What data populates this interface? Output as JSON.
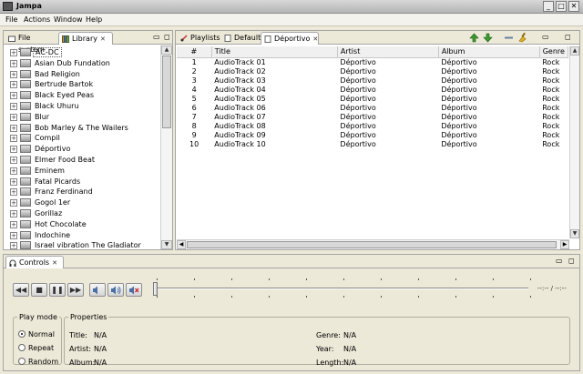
{
  "window": {
    "title": "Jampa",
    "min": "_",
    "max": "□",
    "close": "✕"
  },
  "menu": [
    "File",
    "Actions",
    "Window",
    "Help"
  ],
  "left_tabs": [
    {
      "label": "File system"
    },
    {
      "label": "Library"
    }
  ],
  "artists": [
    "AC-DC",
    "Asian Dub Fundation",
    "Bad Religion",
    "Bertrude Bartok",
    "Black Eyed Peas",
    "Black Uhuru",
    "Blur",
    "Bob Marley & The Wailers",
    "Compil",
    "Déportivo",
    "Elmer Food Beat",
    "Eminem",
    "Fatal Picards",
    "Franz Ferdinand",
    "Gogol 1er",
    "Gorillaz",
    "Hot Chocolate",
    "Indochine",
    "Israel vibration The Gladiator"
  ],
  "right_tabs": [
    {
      "label": "Playlists"
    },
    {
      "label": "Default"
    },
    {
      "label": "Déportivo"
    }
  ],
  "track_table": {
    "columns": [
      "#",
      "Title",
      "Artist",
      "Album",
      "Genre"
    ],
    "rows": [
      [
        "1",
        "AudioTrack 01",
        "Déportivo",
        "Déportivo",
        "Rock"
      ],
      [
        "2",
        "AudioTrack 02",
        "Déportivo",
        "Déportivo",
        "Rock"
      ],
      [
        "3",
        "AudioTrack 03",
        "Déportivo",
        "Déportivo",
        "Rock"
      ],
      [
        "4",
        "AudioTrack 04",
        "Déportivo",
        "Déportivo",
        "Rock"
      ],
      [
        "5",
        "AudioTrack 05",
        "Déportivo",
        "Déportivo",
        "Rock"
      ],
      [
        "6",
        "AudioTrack 06",
        "Déportivo",
        "Déportivo",
        "Rock"
      ],
      [
        "7",
        "AudioTrack 07",
        "Déportivo",
        "Déportivo",
        "Rock"
      ],
      [
        "8",
        "AudioTrack 08",
        "Déportivo",
        "Déportivo",
        "Rock"
      ],
      [
        "9",
        "AudioTrack 09",
        "Déportivo",
        "Déportivo",
        "Rock"
      ],
      [
        "10",
        "AudioTrack 10",
        "Déportivo",
        "Déportivo",
        "Rock"
      ]
    ]
  },
  "controls": {
    "tab_label": "Controls",
    "time_display": "--:-- / --:--",
    "position_fraction": 0.0,
    "buttons": [
      "previous-icon",
      "stop-icon",
      "pause-icon",
      "next-icon",
      "volume-down-icon",
      "volume-up-icon",
      "mute-icon"
    ],
    "play_mode": {
      "legend": "Play mode",
      "options": [
        "Normal",
        "Repeat",
        "Random"
      ],
      "selected": "Normal"
    },
    "properties": {
      "legend": "Properties",
      "title_label": "Title:",
      "title_value": "N/A",
      "artist_label": "Artist:",
      "artist_value": "N/A",
      "album_label": "Album:",
      "album_value": "N/A",
      "genre_label": "Genre:",
      "genre_value": "N/A",
      "year_label": "Year:",
      "year_value": "N/A",
      "length_label": "Length:",
      "length_value": "N/A"
    }
  },
  "colors": {
    "move_up": "#3a9b2e",
    "move_down": "#3a9b2e",
    "selection_border": "#555555"
  }
}
